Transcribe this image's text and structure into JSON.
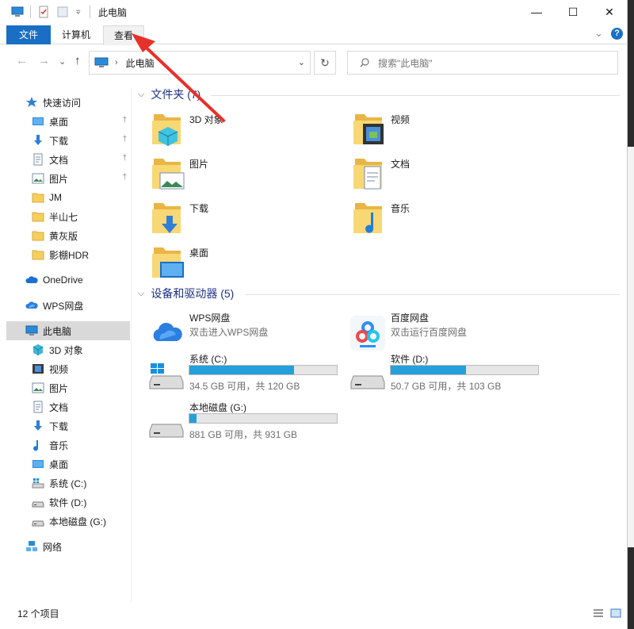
{
  "window": {
    "title": "此电脑",
    "controls": {
      "minimize": "—",
      "maximize": "☐",
      "close": "✕"
    }
  },
  "ribbon": {
    "tabs": [
      {
        "label": "文件"
      },
      {
        "label": "计算机"
      },
      {
        "label": "查看"
      }
    ],
    "collapse_glyph": "⌄",
    "help_glyph": "?"
  },
  "navbar": {
    "back": "←",
    "forward": "→",
    "history": "⌄",
    "up": "↑",
    "address_separator": "›",
    "location": "此电脑",
    "address_dropdown": "⌄",
    "refresh": "↻",
    "search_placeholder": "搜索\"此电脑\""
  },
  "sidebar": {
    "items": [
      {
        "label": "快速访问",
        "icon": "star-icon",
        "pinned": false
      },
      {
        "label": "桌面",
        "icon": "desktop-icon",
        "pinned": true
      },
      {
        "label": "下载",
        "icon": "download-icon",
        "pinned": true
      },
      {
        "label": "文档",
        "icon": "document-icon",
        "pinned": true
      },
      {
        "label": "图片",
        "icon": "picture-icon",
        "pinned": true
      },
      {
        "label": "JM",
        "icon": "folder-icon",
        "pinned": false
      },
      {
        "label": "半山七",
        "icon": "folder-icon",
        "pinned": false
      },
      {
        "label": "黄灰版",
        "icon": "folder-icon",
        "pinned": false
      },
      {
        "label": "影棚HDR",
        "icon": "folder-icon",
        "pinned": false
      },
      {
        "label": "OneDrive",
        "icon": "cloud-icon",
        "pinned": false
      },
      {
        "label": "WPS网盘",
        "icon": "wps-cloud-icon",
        "pinned": false
      },
      {
        "label": "此电脑",
        "icon": "computer-icon",
        "pinned": false,
        "selected": true
      },
      {
        "label": "3D 对象",
        "icon": "cube-icon",
        "pinned": false
      },
      {
        "label": "视频",
        "icon": "video-icon",
        "pinned": false
      },
      {
        "label": "图片",
        "icon": "picture-icon",
        "pinned": false
      },
      {
        "label": "文档",
        "icon": "document-icon",
        "pinned": false
      },
      {
        "label": "下载",
        "icon": "download-icon",
        "pinned": false
      },
      {
        "label": "音乐",
        "icon": "music-icon",
        "pinned": false
      },
      {
        "label": "桌面",
        "icon": "desktop-icon",
        "pinned": false
      },
      {
        "label": "系统 (C:)",
        "icon": "windows-drive-icon",
        "pinned": false
      },
      {
        "label": "软件 (D:)",
        "icon": "drive-icon",
        "pinned": false
      },
      {
        "label": "本地磁盘 (G:)",
        "icon": "drive-icon",
        "pinned": false
      },
      {
        "label": "网络",
        "icon": "network-icon",
        "pinned": false
      }
    ],
    "pin_glyph": "📌"
  },
  "content": {
    "folders_header": "文件夹 (7)",
    "folders": [
      {
        "label": "3D 对象",
        "icon": "cube-folder-icon"
      },
      {
        "label": "视频",
        "icon": "video-folder-icon"
      },
      {
        "label": "图片",
        "icon": "picture-folder-icon"
      },
      {
        "label": "文档",
        "icon": "document-folder-icon"
      },
      {
        "label": "下载",
        "icon": "download-folder-icon"
      },
      {
        "label": "音乐",
        "icon": "music-folder-icon"
      },
      {
        "label": "桌面",
        "icon": "desktop-folder-icon"
      }
    ],
    "devices_header": "设备和驱动器 (5)",
    "clouds": [
      {
        "name": "WPS网盘",
        "subtitle": "双击进入WPS网盘",
        "icon": "wps-cloud-icon"
      },
      {
        "name": "百度网盘",
        "subtitle": "双击运行百度网盘",
        "icon": "baidu-netdisk-icon"
      }
    ],
    "drives": [
      {
        "name": "系统 (C:)",
        "free": "34.5 GB 可用，共 120 GB",
        "used_fraction": 0.71,
        "icon": "windows-drive-icon"
      },
      {
        "name": "软件 (D:)",
        "free": "50.7 GB 可用，共 103 GB",
        "used_fraction": 0.51,
        "icon": "drive-icon"
      },
      {
        "name": "本地磁盘 (G:)",
        "free": "881 GB 可用，共 931 GB",
        "used_fraction": 0.05,
        "icon": "drive-icon"
      }
    ]
  },
  "status": {
    "item_count": "12 个项目"
  },
  "colors": {
    "accent": "#1a6fc4",
    "bar_fill": "#26a0da",
    "annotation": "#e8302a",
    "group_header": "#1e3287"
  }
}
